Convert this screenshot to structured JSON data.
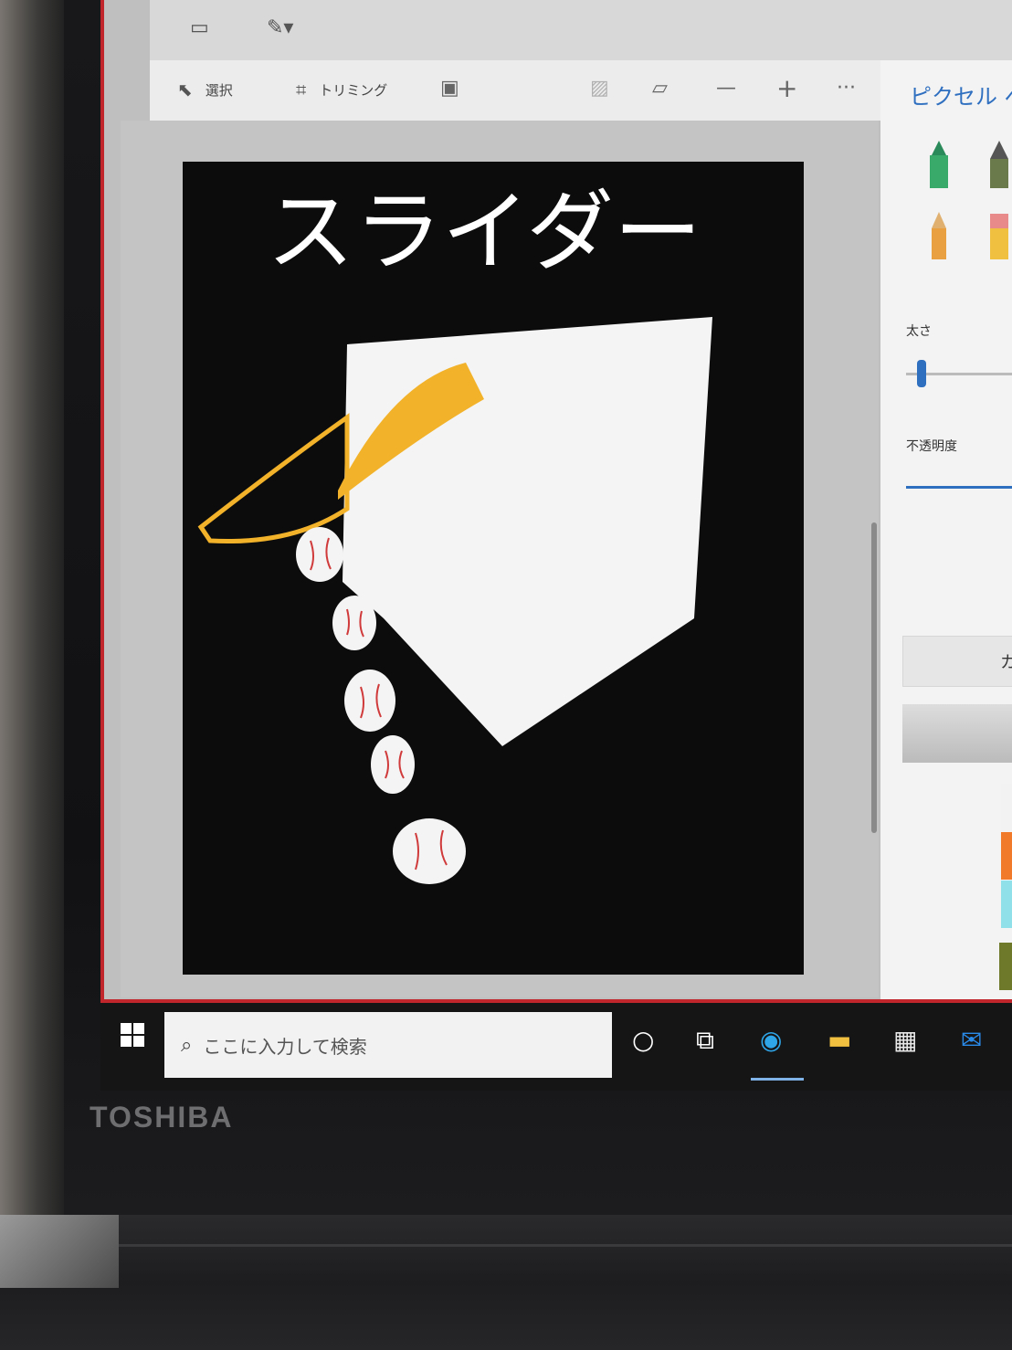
{
  "toolbar": {
    "select_label": "選択",
    "crop_label": "トリミング"
  },
  "canvas": {
    "title_text": "スライダー"
  },
  "panel": {
    "title": "ピクセル ペ",
    "thickness_label": "太さ",
    "opacity_label": "不透明度",
    "button_fragment": "カ",
    "add_label": "+",
    "swatches": [
      "#f2f2f2",
      "#b5b5b5",
      "#2a2a2a",
      "#f07a2a",
      "#f2b52a",
      "#f2d68a",
      "#8fe0e8",
      "#2a9ae8",
      "#1a4ac0"
    ],
    "custom_color": "#6e7a2a"
  },
  "taskbar": {
    "search_placeholder": "ここに入力して検索"
  },
  "device": {
    "brand": "TOSHIBA"
  },
  "colors": {
    "accent": "#2f6fc0",
    "window_border": "#c0262c",
    "brush_yellow": "#f2b22a"
  }
}
